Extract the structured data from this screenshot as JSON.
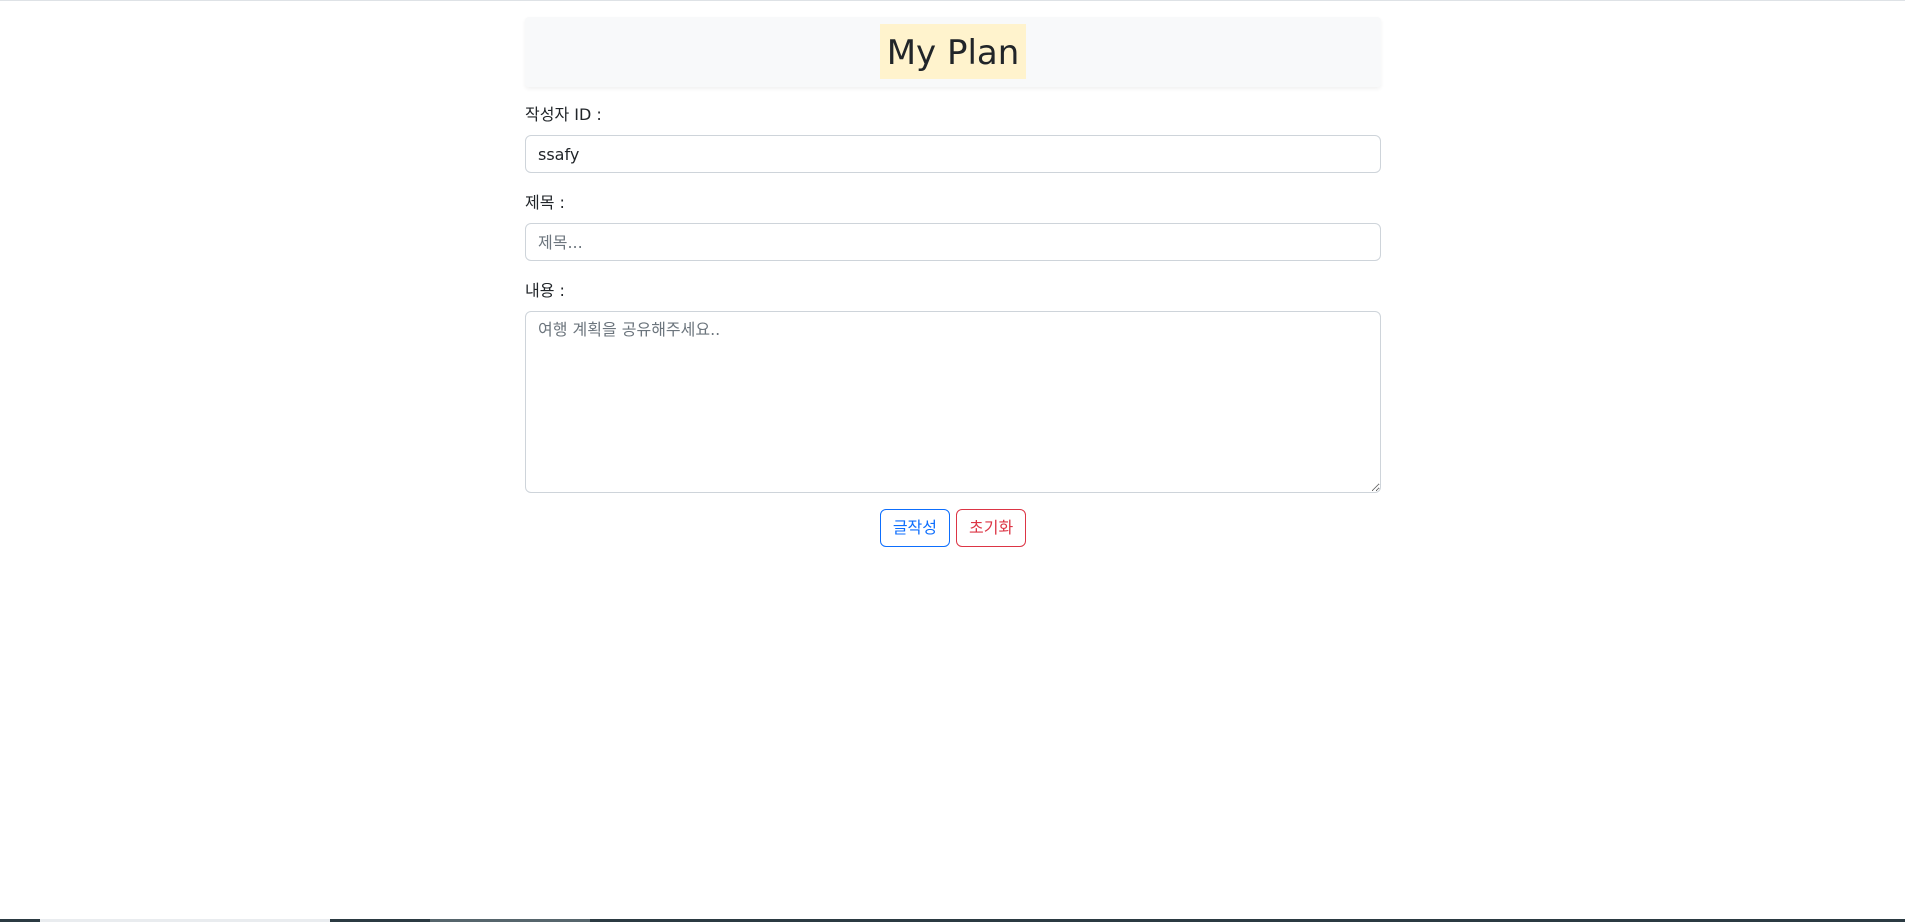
{
  "header": {
    "title": "My Plan"
  },
  "form": {
    "writer_label": "작성자 ID :",
    "writer_value": "ssafy",
    "title_label": "제목 :",
    "title_placeholder": "제목...",
    "content_label": "내용 :",
    "content_placeholder": "여행 계획을 공유해주세요.."
  },
  "actions": {
    "submit_label": "글작성",
    "reset_label": "초기화"
  },
  "colors": {
    "header_bg": "#f8f9fa",
    "title_highlight": "#fff3cd",
    "primary": "#0d6efd",
    "danger": "#dc3545"
  }
}
